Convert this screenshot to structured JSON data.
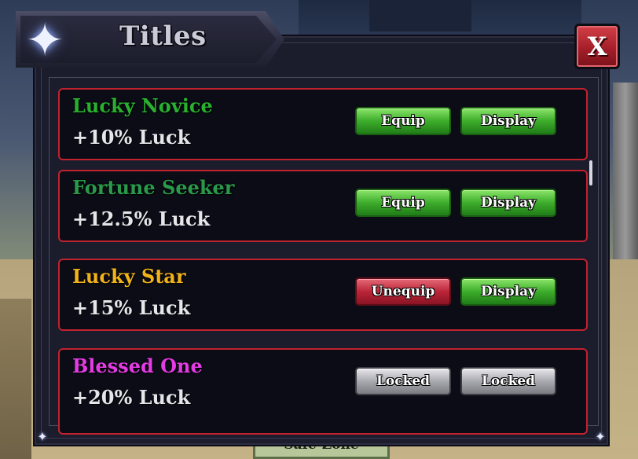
{
  "window": {
    "title": "Titles",
    "close_label": "X"
  },
  "scene": {
    "sign_label": "Safe-Zone"
  },
  "colors": {
    "row_border": "#c0232e",
    "name_green": "#29b02f",
    "name_teal": "#2a9a4a",
    "name_gold": "#f2b21a",
    "name_magenta": "#e53be6",
    "equip_button": "#3dac2b",
    "unequip_button": "#bb2538",
    "locked_button": "#a9a9b0"
  },
  "titles": [
    {
      "name": "Lucky Novice",
      "name_color": "#29b02f",
      "bonus": "+10% Luck",
      "primary_button": {
        "label": "Equip",
        "style": "green"
      },
      "secondary_button": {
        "label": "Display",
        "style": "green"
      }
    },
    {
      "name": "Fortune Seeker",
      "name_color": "#2a9a4a",
      "bonus": "+12.5% Luck",
      "primary_button": {
        "label": "Equip",
        "style": "green"
      },
      "secondary_button": {
        "label": "Display",
        "style": "green"
      }
    },
    {
      "name": "Lucky Star",
      "name_color": "#f2b21a",
      "bonus": "+15% Luck",
      "primary_button": {
        "label": "Unequip",
        "style": "red"
      },
      "secondary_button": {
        "label": "Display",
        "style": "green"
      }
    },
    {
      "name": "Blessed One",
      "name_color": "#e53be6",
      "bonus": "+20% Luck",
      "primary_button": {
        "label": "Locked",
        "style": "grey"
      },
      "secondary_button": {
        "label": "Locked",
        "style": "grey"
      }
    }
  ]
}
